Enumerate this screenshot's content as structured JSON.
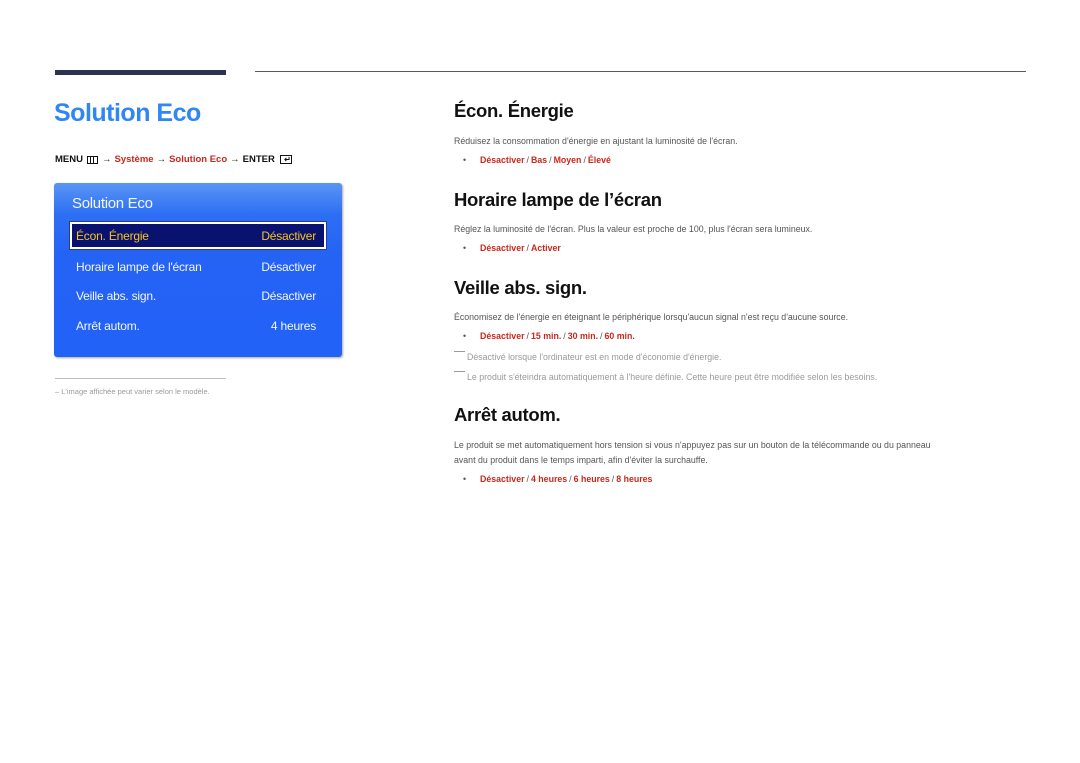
{
  "page": {
    "title": "Solution Eco",
    "breadcrumb": {
      "menu": "MENU",
      "menu_icon": "menu-icon",
      "arrow": "→",
      "step1": "Système",
      "step2": "Solution Eco",
      "enter": "ENTER",
      "enter_icon": "enter-icon"
    },
    "footnote": "L'image affichée peut varier selon le modèle.",
    "footnote_dash": "–"
  },
  "osd": {
    "title": "Solution Eco",
    "rows": [
      {
        "label": "Écon. Énergie",
        "value": "Désactiver",
        "selected": true
      },
      {
        "label": "Horaire lampe de l'écran",
        "value": "Désactiver",
        "selected": false
      },
      {
        "label": "Veille abs. sign.",
        "value": "Désactiver",
        "selected": false
      },
      {
        "label": "Arrêt autom.",
        "value": "4 heures",
        "selected": false
      }
    ]
  },
  "sections": [
    {
      "heading": "Écon. Énergie",
      "description": "Réduisez la consommation d'énergie en ajustant la luminosité de l'écran.",
      "options": [
        "Désactiver",
        "Bas",
        "Moyen",
        "Élevé"
      ]
    },
    {
      "heading": "Horaire lampe de l’écran",
      "description": "Réglez la luminosité de l'écran. Plus la valeur est proche de 100, plus l'écran sera lumineux.",
      "options": [
        "Désactiver",
        "Activer"
      ]
    },
    {
      "heading": "Veille abs. sign.",
      "description": "Économisez de l'énergie en éteignant le périphérique lorsqu'aucun signal n'est reçu d'aucune source.",
      "options": [
        "Désactiver",
        "15 min.",
        "30 min.",
        "60 min."
      ],
      "notes": [
        "Désactivé lorsque l'ordinateur est en mode d'économie d'énergie.",
        "Le produit s'éteindra automatiquement à l'heure définie. Cette heure peut être modifiée selon les besoins."
      ]
    },
    {
      "heading": "Arrêt autom.",
      "description_lines": [
        "Le produit se met automatiquement hors tension si vous n'appuyez pas sur un bouton de la télécommande ou du panneau",
        "avant du produit dans le temps imparti, afin d'éviter la surchauffe."
      ],
      "options": [
        "Désactiver",
        "4 heures",
        "6 heures",
        "8 heures"
      ]
    }
  ],
  "bullet": "•",
  "separator": "/",
  "colors": {
    "title_blue": "#2f87f5",
    "option_red": "#c8281c",
    "osd_blue": "#2262f6",
    "osd_selected_bg": "#0a1270",
    "osd_selected_text": "#f5c51e"
  }
}
